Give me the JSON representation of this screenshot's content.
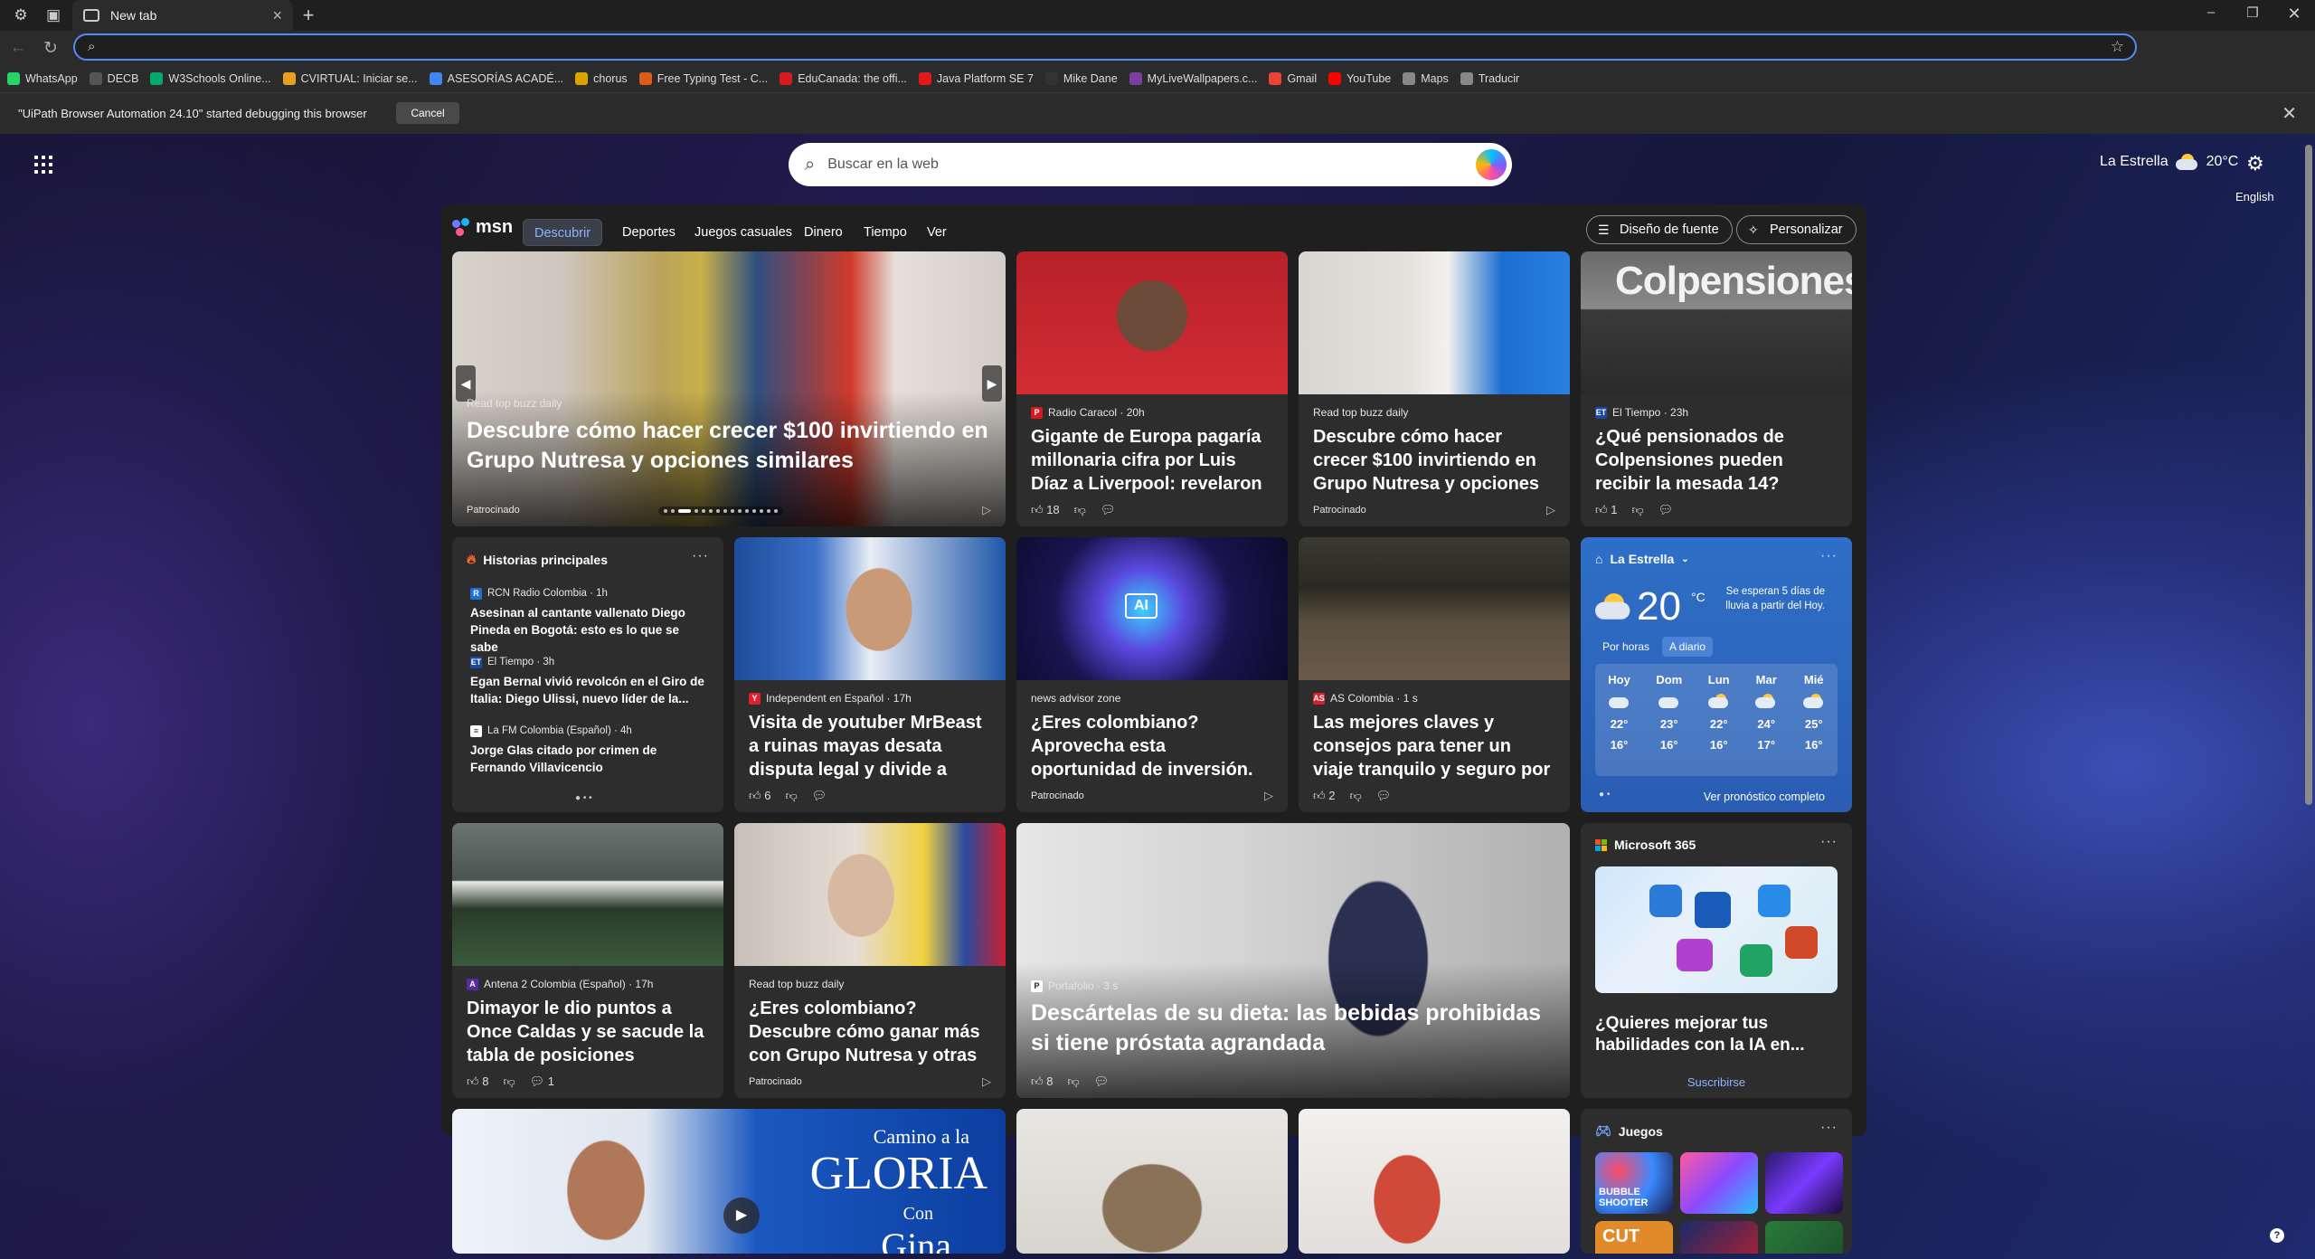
{
  "browser": {
    "tab_title": "New tab",
    "address_value": "",
    "bookmarks": [
      {
        "label": "WhatsApp",
        "color": "#25d366"
      },
      {
        "label": "DECB",
        "color": "#555555"
      },
      {
        "label": "W3Schools Online...",
        "color": "#04aa6d"
      },
      {
        "label": "CVIRTUAL: Iniciar se...",
        "color": "#e8a020"
      },
      {
        "label": "ASESORÍAS ACADÉ...",
        "color": "#4285f4"
      },
      {
        "label": "chorus",
        "color": "#d9a400"
      },
      {
        "label": "Free Typing Test - C...",
        "color": "#e05a1a"
      },
      {
        "label": "EduCanada: the offi...",
        "color": "#d71920"
      },
      {
        "label": "Java Platform SE 7",
        "color": "#e01a1a"
      },
      {
        "label": "Mike Dane",
        "color": "#333333"
      },
      {
        "label": "MyLiveWallpapers.c...",
        "color": "#7a3fa0"
      },
      {
        "label": "Gmail",
        "color": "#ea4335"
      },
      {
        "label": "YouTube",
        "color": "#ff0000"
      },
      {
        "label": "Maps",
        "color": "#888888"
      },
      {
        "label": "Traducir",
        "color": "#888888"
      }
    ],
    "infobar": {
      "message": "\"UiPath Browser Automation 24.10\" started debugging this browser",
      "cancel": "Cancel"
    }
  },
  "newtab": {
    "search_placeholder": "Buscar en la web",
    "weather_location": "La Estrella",
    "weather_temp": "20°C",
    "language": "English"
  },
  "feed": {
    "brand": "msn",
    "nav": [
      "Descubrir",
      "Deportes",
      "Juegos casuales",
      "Dinero",
      "Tiempo",
      "Ver"
    ],
    "feed_layout": "Diseño de fuente",
    "personalize": "Personalizar"
  },
  "cards": {
    "hero": {
      "source": "Read top buzz daily",
      "title": "Descubre cómo hacer crecer $100 invirtiendo en Grupo Nutresa y opciones similares",
      "sponsored": "Patrocinado"
    },
    "c1": {
      "source": "Radio Caracol · 20h",
      "title": "Gigante de Europa pagaría millonaria cifra por Luis Díaz a Liverpool: revelaron el...",
      "likes": "18"
    },
    "c2": {
      "source": "Read top buzz daily",
      "title": "Descubre cómo hacer crecer $100 invirtiendo en Grupo Nutresa y opciones similares",
      "sponsored": "Patrocinado"
    },
    "c3": {
      "source": "El Tiempo · 23h",
      "title": "¿Qué pensionados de Colpensiones pueden recibir la mesada 14?",
      "likes": "1",
      "img_text": "Colpensiones"
    },
    "c4": {
      "source": "Independent en Español · 17h",
      "title": "Visita de youtuber MrBeast a ruinas mayas desata disputa legal y divide a autoridades...",
      "likes": "6"
    },
    "c5": {
      "source": "news advisor zone",
      "title": "¿Eres colombiano? Aprovecha esta oportunidad de inversión.",
      "sponsored": "Patrocinado"
    },
    "c6": {
      "source": "AS Colombia · 1 s",
      "title": "Las mejores claves y consejos para tener un viaje tranquilo y seguro por el interior de...",
      "likes": "2"
    },
    "c7": {
      "source": "Antena 2 Colombia (Español) · 17h",
      "title": "Dimayor le dio puntos a Once Caldas y se sacude la tabla de posiciones",
      "likes": "8",
      "comments": "1"
    },
    "c8": {
      "source": "Read top buzz daily",
      "title": "¿Eres colombiano? Descubre cómo ganar más con Grupo Nutresa y otras empresas.",
      "sponsored": "Patrocinado"
    },
    "c9": {
      "source": "Portafolio · 3 s",
      "title": "Descártelas de su dieta: las bebidas prohibidas si tiene próstata agrandada",
      "likes": "8"
    },
    "video": {
      "line1": "Camino a la",
      "line2": "GLORIA",
      "line3": "Con",
      "line4": "Gina"
    }
  },
  "top_stories": {
    "title": "Historias principales",
    "items": [
      {
        "source": "RCN Radio Colombia · 1h",
        "title": "Asesinan al cantante vallenato Diego Pineda en Bogotá: esto es lo que se sabe"
      },
      {
        "source": "El Tiempo · 3h",
        "title": "Egan Bernal vivió revolcón en el Giro de Italia: Diego Ulissi, nuevo líder de la..."
      },
      {
        "source": "La FM Colombia (Español) · 4h",
        "title": "Jorge Glas citado por crimen de Fernando Villavicencio"
      }
    ]
  },
  "weather_widget": {
    "location": "La Estrella",
    "temp": "20",
    "unit": "°C",
    "note": "Se esperan 5 días de lluvia a partir del Hoy.",
    "tab_hourly": "Por horas",
    "tab_daily": "A diario",
    "days": [
      {
        "day": "Hoy",
        "hi": "22°",
        "lo": "16°"
      },
      {
        "day": "Dom",
        "hi": "23°",
        "lo": "16°"
      },
      {
        "day": "Lun",
        "hi": "22°",
        "lo": "16°"
      },
      {
        "day": "Mar",
        "hi": "24°",
        "lo": "17°"
      },
      {
        "day": "Mié",
        "hi": "25°",
        "lo": "16°"
      }
    ],
    "full": "Ver pronóstico completo"
  },
  "m365": {
    "title": "Microsoft 365",
    "text": "¿Quieres mejorar tus habilidades con la IA en...",
    "cta": "Suscribirse"
  },
  "games": {
    "title": "Juegos",
    "bubble": "BUBBLE SHOOTER",
    "cut": "CUT"
  }
}
